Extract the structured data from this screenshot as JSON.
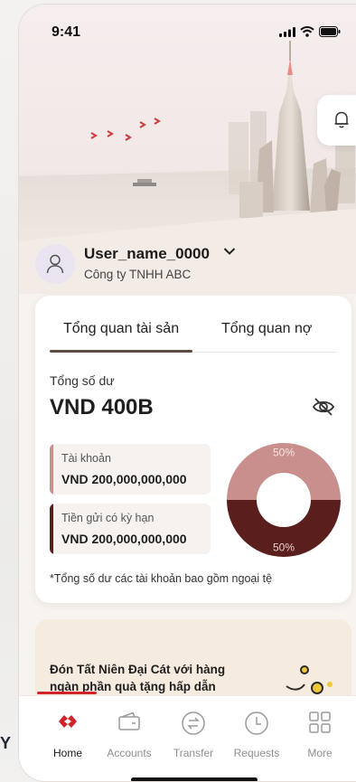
{
  "status_bar": {
    "time": "9:41"
  },
  "backdrop": {
    "edge_letter": "Y"
  },
  "user": {
    "name": "User_name_0000",
    "company": "Công ty TNHH ABC"
  },
  "overview": {
    "tabs": [
      {
        "label": "Tổng quan tài sản",
        "active": true
      },
      {
        "label": "Tổng quan nợ",
        "active": false
      }
    ],
    "total_label": "Tổng số dư",
    "total_value": "VND 400B",
    "accounts": [
      {
        "label": "Tài khoản",
        "value": "VND 200,000,000,000",
        "color": "#c98f8d"
      },
      {
        "label": "Tiền gửi có kỳ hạn",
        "value": "VND 200,000,000,000",
        "color": "#5a1f1d"
      }
    ],
    "footnote": "*Tổng số dư các tài khoản bao gồm ngoại tệ"
  },
  "chart_data": {
    "type": "pie",
    "categories": [
      "Tài khoản",
      "Tiền gửi có kỳ hạn"
    ],
    "values": [
      50,
      50
    ],
    "labels": [
      "50%",
      "50%"
    ],
    "colors": [
      "#c98f8d",
      "#5a1f1d"
    ]
  },
  "promo": {
    "text": "Đón Tất Niên Đại Cát với hàng ngàn phần quà tặng hấp dẫn"
  },
  "nav": [
    {
      "label": "Home",
      "icon": "home-logo-icon",
      "active": true
    },
    {
      "label": "Accounts",
      "icon": "wallet-icon",
      "active": false
    },
    {
      "label": "Transfer",
      "icon": "transfer-icon",
      "active": false
    },
    {
      "label": "Requests",
      "icon": "clock-icon",
      "active": false
    },
    {
      "label": "More",
      "icon": "grid-icon",
      "active": false
    }
  ],
  "colors": {
    "brand_red": "#d2222a",
    "accent_dark": "#5e4b43",
    "light_segment": "#c98f8d",
    "dark_segment": "#5a1f1d"
  }
}
